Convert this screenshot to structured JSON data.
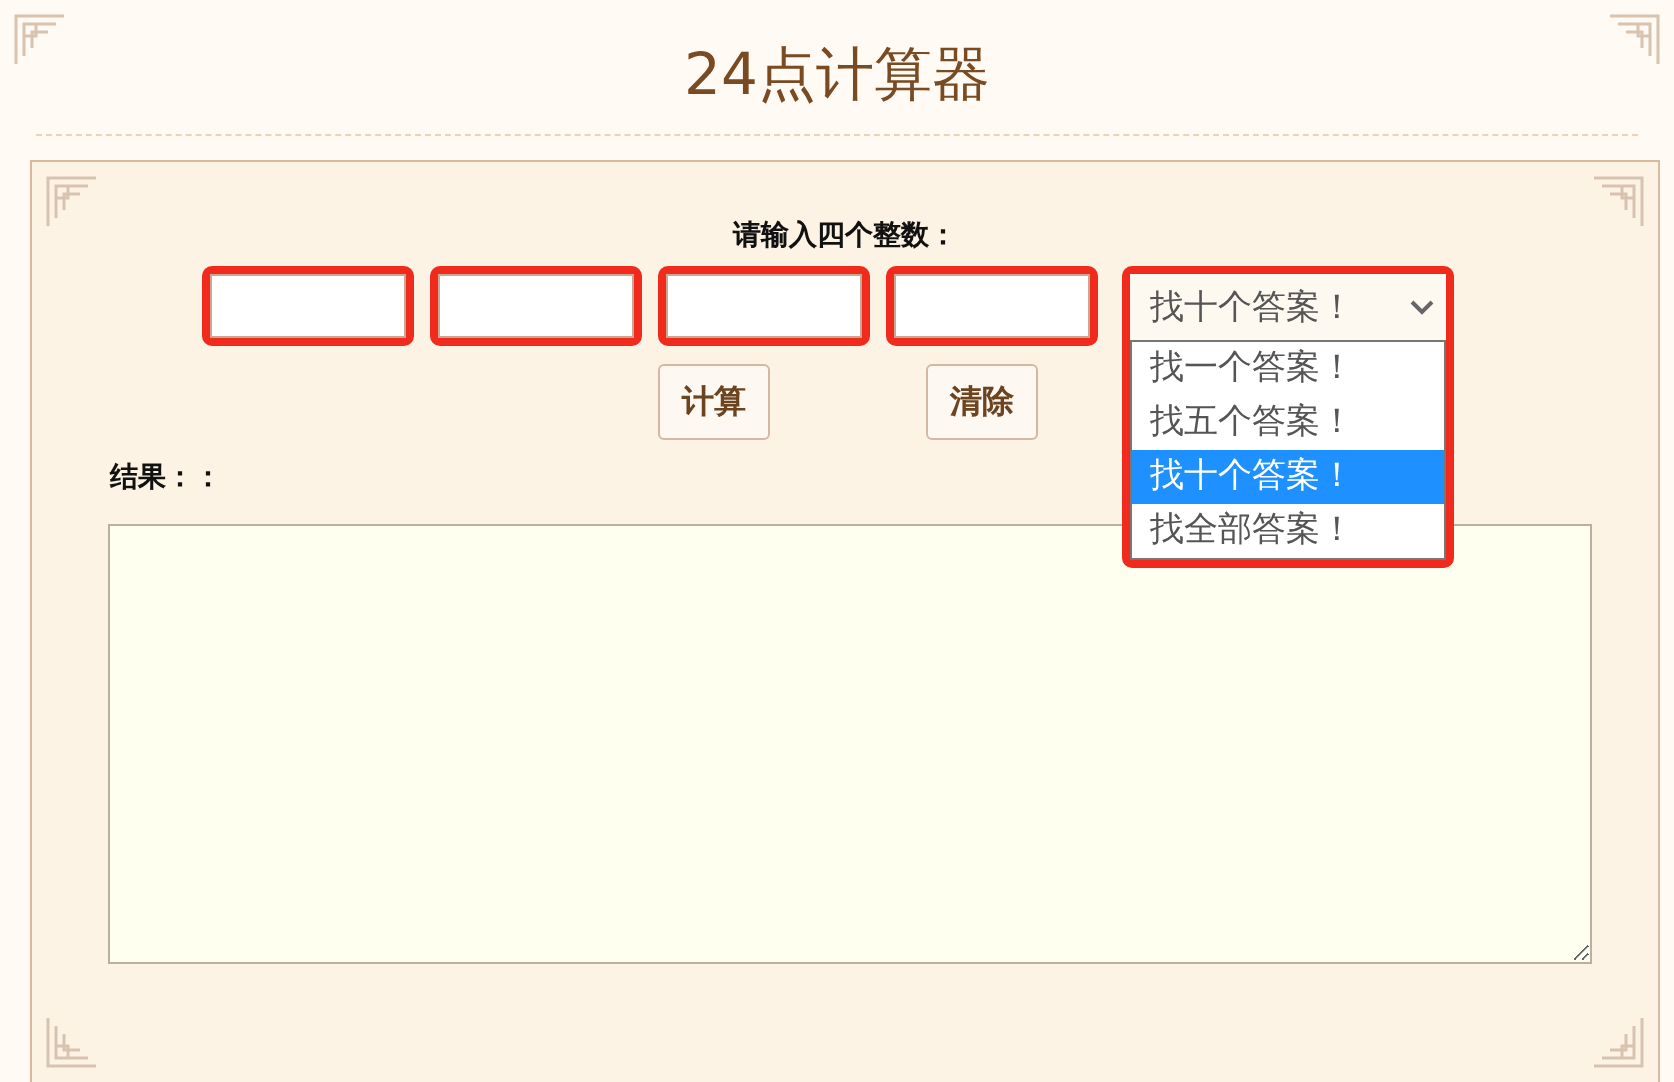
{
  "title": "24点计算器",
  "prompt": "请输入四个整数：",
  "inputs": [
    {
      "highlighted": true
    },
    {
      "highlighted": true
    },
    {
      "highlighted": true
    },
    {
      "highlighted": true
    }
  ],
  "answer_select": {
    "value": "找十个答案！",
    "expanded": true,
    "highlighted": true,
    "options": [
      {
        "label": "找一个答案！",
        "selected": false
      },
      {
        "label": "找五个答案！",
        "selected": false
      },
      {
        "label": "找十个答案！",
        "selected": true
      },
      {
        "label": "找全部答案！",
        "selected": false
      }
    ]
  },
  "buttons": [
    {
      "label": "计算"
    },
    {
      "label": "清除"
    }
  ],
  "result_label": "结果：："
}
